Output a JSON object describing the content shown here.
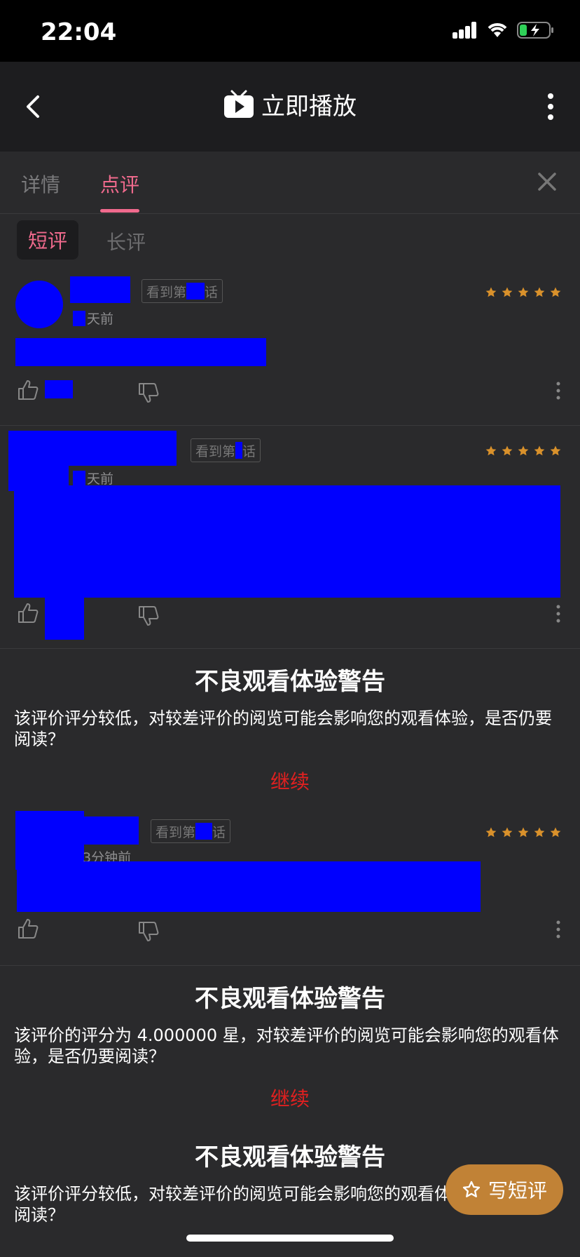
{
  "status_bar": {
    "time": "22:04"
  },
  "nav": {
    "title": "立即播放"
  },
  "tabs": [
    {
      "label": "详情",
      "active": false
    },
    {
      "label": "点评",
      "active": true
    }
  ],
  "subtabs": [
    {
      "label": "短评",
      "active": true
    },
    {
      "label": "长评",
      "active": false
    }
  ],
  "reviews": [
    {
      "episode_prefix": "看到第",
      "episode_suffix": "话",
      "time_suffix": "天前",
      "stars": 5
    },
    {
      "episode_prefix": "看到第",
      "episode_suffix": "话",
      "time_suffix": "天前",
      "stars": 5
    },
    {
      "episode_prefix": "看到第",
      "episode_suffix": "话",
      "time_text": "3分钟前",
      "stars": 5
    }
  ],
  "warnings": [
    {
      "title": "不良观看体验警告",
      "body": "该评价评分较低，对较差评价的阅览可能会影响您的观看体验，是否仍要阅读？",
      "action": "继续"
    },
    {
      "title": "不良观看体验警告",
      "body": "该评价的评分为 4.000000 星，对较差评价的阅览可能会影响您的观看体验，是否仍要阅读？",
      "action": "继续"
    },
    {
      "title": "不良观看体验警告",
      "body": "该评价评分较低，对较差评价的阅览可能会影响您的观看体验，是否仍要阅读？"
    }
  ],
  "write_button": {
    "label": "写短评"
  },
  "colors": {
    "accent": "#f06a8d",
    "star": "#d9912b",
    "continue": "#e02020",
    "fab": "#c18236"
  }
}
